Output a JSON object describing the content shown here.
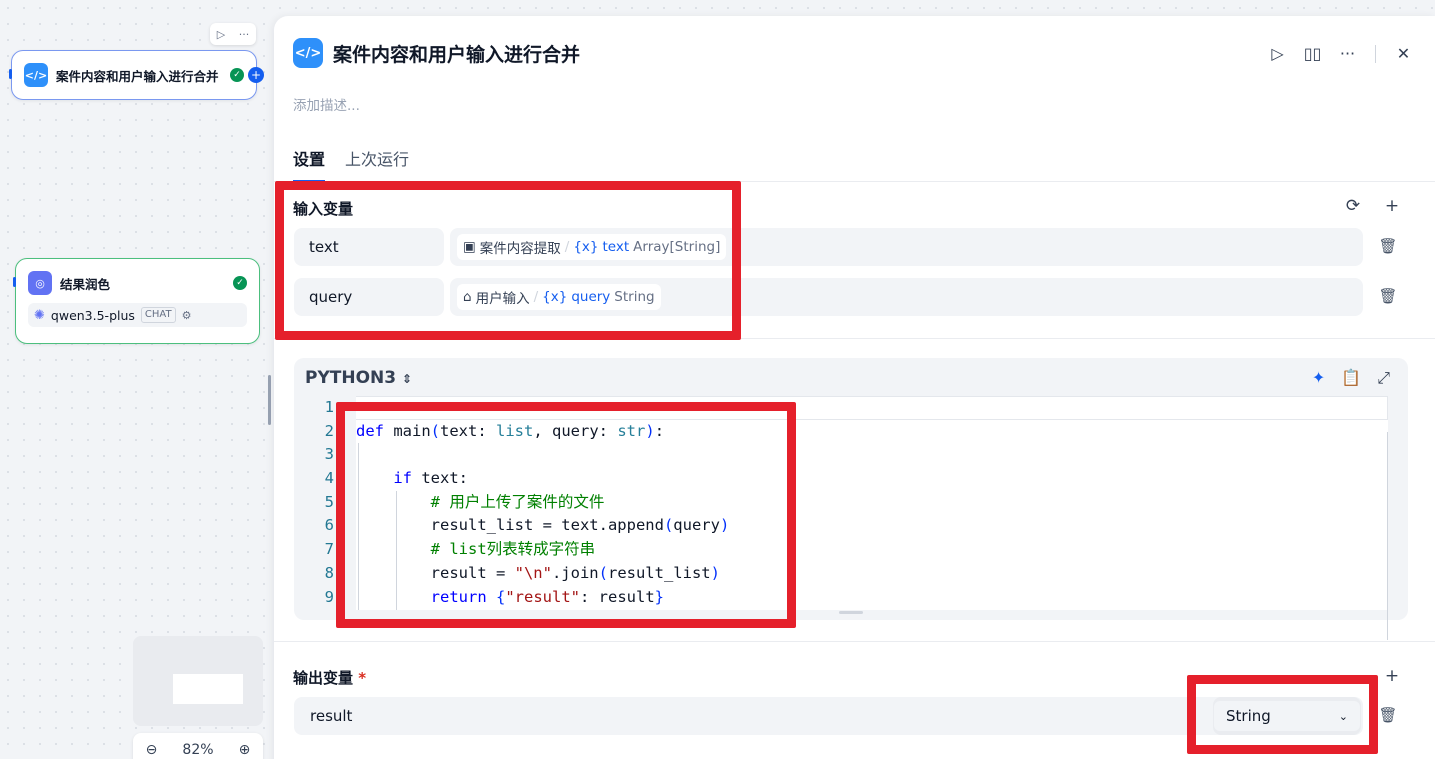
{
  "canvas": {
    "code_node": {
      "title": "案件内容和用户输入进行合并",
      "toolbar_run": "▷",
      "toolbar_more": "···"
    },
    "llm_node": {
      "title": "结果润色",
      "model": "qwen3.5-plus",
      "model_badge": "CHAT"
    },
    "zoom": {
      "minus": "⊖",
      "level": "82%",
      "plus": "⊕"
    }
  },
  "panel": {
    "title": "案件内容和用户输入进行合并",
    "description_placeholder": "添加描述...",
    "actions": {
      "run": "▷",
      "docs": "📖",
      "more": "···",
      "close": "✕"
    },
    "tabs": [
      {
        "label": "设置"
      },
      {
        "label": "上次运行"
      }
    ],
    "input_section": {
      "label": "输入变量",
      "variables": [
        {
          "name": "text",
          "source_node": "案件内容提取",
          "var": "text",
          "type": "Array[String]"
        },
        {
          "name": "query",
          "source_node": "用户输入",
          "var": "query",
          "type": "String"
        }
      ]
    },
    "code": {
      "language": "PYTHON3",
      "line_numbers": [
        "1",
        "2",
        "3",
        "4",
        "5",
        "6",
        "7",
        "8",
        "9"
      ]
    },
    "output_section": {
      "label": "输出变量",
      "required_mark": "*",
      "variables": [
        {
          "name": "result",
          "type": "String"
        }
      ]
    }
  },
  "colors": {
    "accent": "#155eef",
    "annotation": "#e5202b",
    "success": "#079455"
  }
}
